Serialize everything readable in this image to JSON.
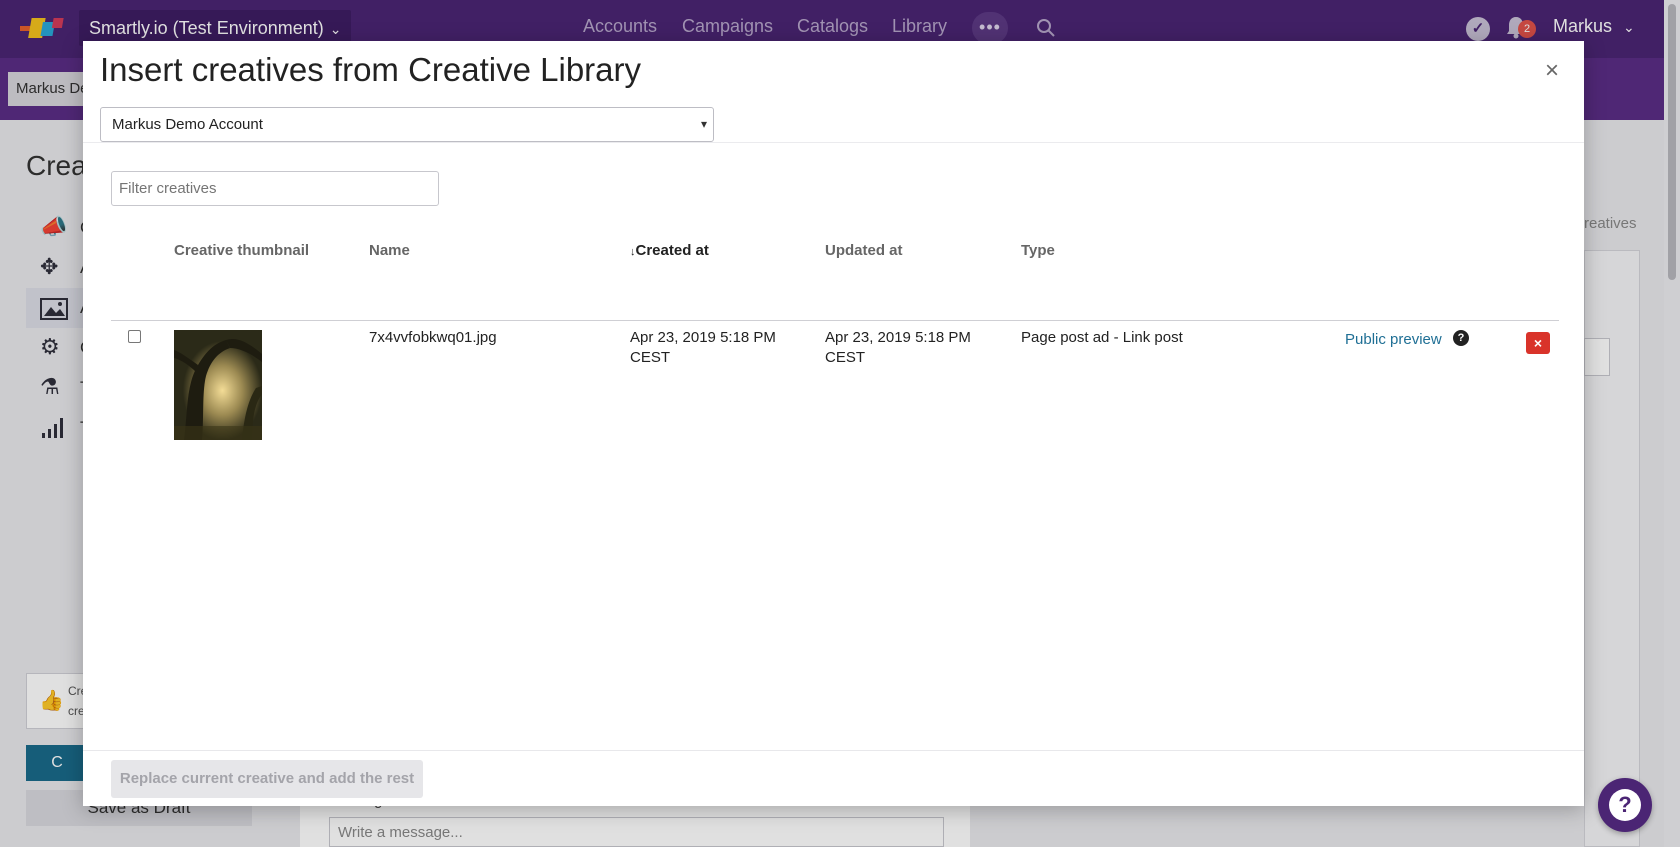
{
  "app": {
    "environment_label": "Smartly.io (Test Environment)",
    "nav": [
      "Accounts",
      "Campaigns",
      "Catalogs",
      "Library"
    ],
    "more_label": "•••",
    "notification_count": "2",
    "user_name": "Markus",
    "brand_color": "#4b2574"
  },
  "background": {
    "account_chip": "Markus De",
    "page_heading": "Crea",
    "sidebar_labels": [
      "C",
      "A",
      "A",
      "C",
      "T",
      "T"
    ],
    "tip_lines": [
      "Cre",
      "cre"
    ],
    "primary_button": "C",
    "draft_button": "Save as Draft",
    "right_link": "reatives",
    "message_label": "Message",
    "message_placeholder": "Write a message..."
  },
  "modal": {
    "title": "Insert creatives from Creative Library",
    "account_select": "Markus Demo Account",
    "filter_placeholder": "Filter creatives",
    "columns": {
      "thumbnail": "Creative thumbnail",
      "name": "Name",
      "created": "Created at",
      "updated": "Updated at",
      "type": "Type"
    },
    "sort_indicator": "↓",
    "rows": [
      {
        "name": "7x4vvfobkwq01.jpg",
        "created_line1": "Apr 23, 2019 5:18 PM",
        "created_line2": "CEST",
        "updated_line1": "Apr 23, 2019 5:18 PM",
        "updated_line2": "CEST",
        "type": "Page post ad - Link post",
        "preview_label": "Public preview",
        "checked": false
      }
    ],
    "replace_button": "Replace current creative and add the rest",
    "delete_color": "#d9332a",
    "link_color": "#1f6f95"
  }
}
